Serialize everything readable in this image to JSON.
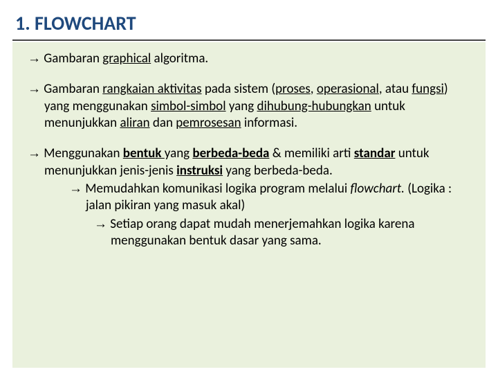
{
  "title": "1. FLOWCHART",
  "arrow": "→",
  "p1": {
    "t1": " Gambaran ",
    "u1": "graphical",
    "t2": " algoritma."
  },
  "p2": {
    "t1": " Gambaran ",
    "u1": "rangkaian aktivitas",
    "t2": " pada sistem (",
    "u2": "proses",
    "t3": ", ",
    "u3": "operasional",
    "t4": ", atau ",
    "u4": "fungsi",
    "t5": ") yang menggunakan ",
    "u5": "simbol-simbol",
    "t6": " yang ",
    "u6": "dihubung-hubungkan",
    "t7": " untuk menunjukkan ",
    "u7": "aliran",
    "t8": " dan ",
    "u8": "pemrosesan",
    "t9": " informasi."
  },
  "p3": {
    "t1": " Menggunakan ",
    "u1": "bentuk ",
    "t2": "yang ",
    "u2": "berbeda-beda",
    "t3": " & memiliki arti ",
    "u3": "standar",
    "t4": " untuk menunjukkan jenis-jenis ",
    "u4": "instruksi",
    "t5": " yang berbeda-beda."
  },
  "p3a": {
    "t1": " Memudahkan komunikasi logika program melalui ",
    "i1": "flowchart.",
    "t2": " (Logika : jalan pikiran yang masuk akal)"
  },
  "p3b": {
    "t1": " Setiap orang dapat mudah menerjemahkan logika karena menggunakan bentuk dasar yang sama."
  }
}
